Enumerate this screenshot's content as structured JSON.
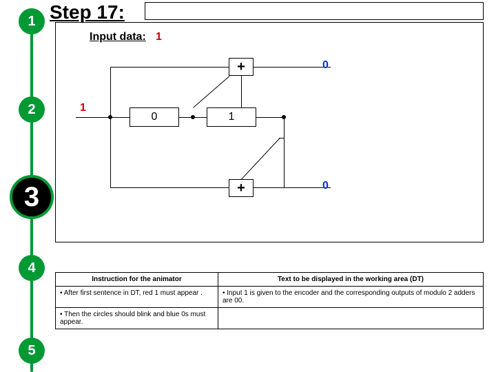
{
  "steps": {
    "s1": "1",
    "s2": "2",
    "s3": "3",
    "s4": "4",
    "s5": "5"
  },
  "title": "Step 17:",
  "input_label": "Input data:",
  "input_value": "1",
  "diagram": {
    "adder_symbol": "+",
    "reg0": "0",
    "reg1": "1",
    "in_label": "1",
    "out_top": "0",
    "out_bot": "0"
  },
  "table": {
    "h1": "Instruction for the animator",
    "h2": "Text to be displayed in the working area (DT)",
    "r1c1": "After first sentence in DT, red 1 must appear .",
    "r1c2": "Input 1 is given to the encoder and the corresponding outputs of modulo 2 adders are 00.",
    "r2c1": "Then the circles should blink and blue 0s must appear."
  }
}
